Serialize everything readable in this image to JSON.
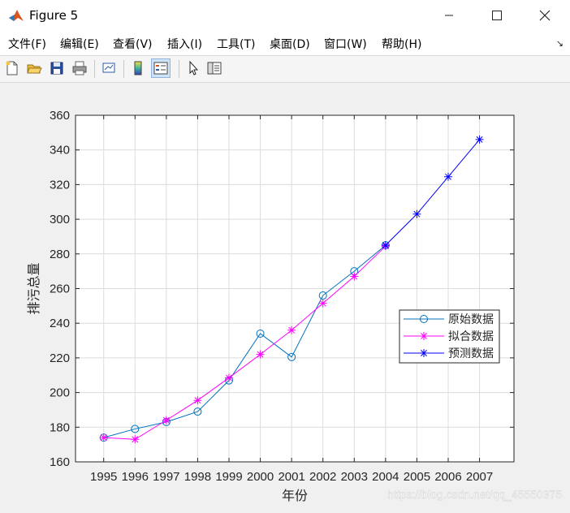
{
  "window": {
    "title": "Figure 5"
  },
  "menu": [
    "文件(F)",
    "编辑(E)",
    "查看(V)",
    "插入(I)",
    "工具(T)",
    "桌面(D)",
    "窗口(W)",
    "帮助(H)"
  ],
  "watermark": "https://blog.csdn.net/qq_45550375",
  "chart_data": {
    "type": "line",
    "title": "",
    "xlabel": "年份",
    "ylabel": "排污总量",
    "x": [
      1995,
      1996,
      1997,
      1998,
      1999,
      2000,
      2001,
      2002,
      2003,
      2004,
      2005,
      2006,
      2007
    ],
    "xlim": [
      1994.1,
      2008.1
    ],
    "ylim": [
      160,
      360
    ],
    "yticks": [
      160,
      180,
      200,
      220,
      240,
      260,
      280,
      300,
      320,
      340,
      360
    ],
    "grid": true,
    "legend_position": "lower-right",
    "series": [
      {
        "name": "原始数据",
        "color": "#0072bd",
        "marker": "circle",
        "x": [
          1995,
          1996,
          1997,
          1998,
          1999,
          2000,
          2001,
          2002,
          2003,
          2004
        ],
        "values": [
          174,
          179,
          183,
          189,
          207,
          234,
          220.5,
          256,
          270,
          285
        ]
      },
      {
        "name": "拟合数据",
        "color": "#ff00ff",
        "marker": "star",
        "x": [
          1995,
          1996,
          1997,
          1998,
          1999,
          2000,
          2001,
          2002,
          2003,
          2004
        ],
        "values": [
          174,
          173,
          184,
          195.5,
          208.5,
          222,
          236,
          251.5,
          267,
          284.5
        ]
      },
      {
        "name": "预测数据",
        "color": "#0000ff",
        "marker": "star",
        "x": [
          2004,
          2005,
          2006,
          2007
        ],
        "values": [
          285,
          303,
          324.5,
          346
        ]
      }
    ]
  }
}
